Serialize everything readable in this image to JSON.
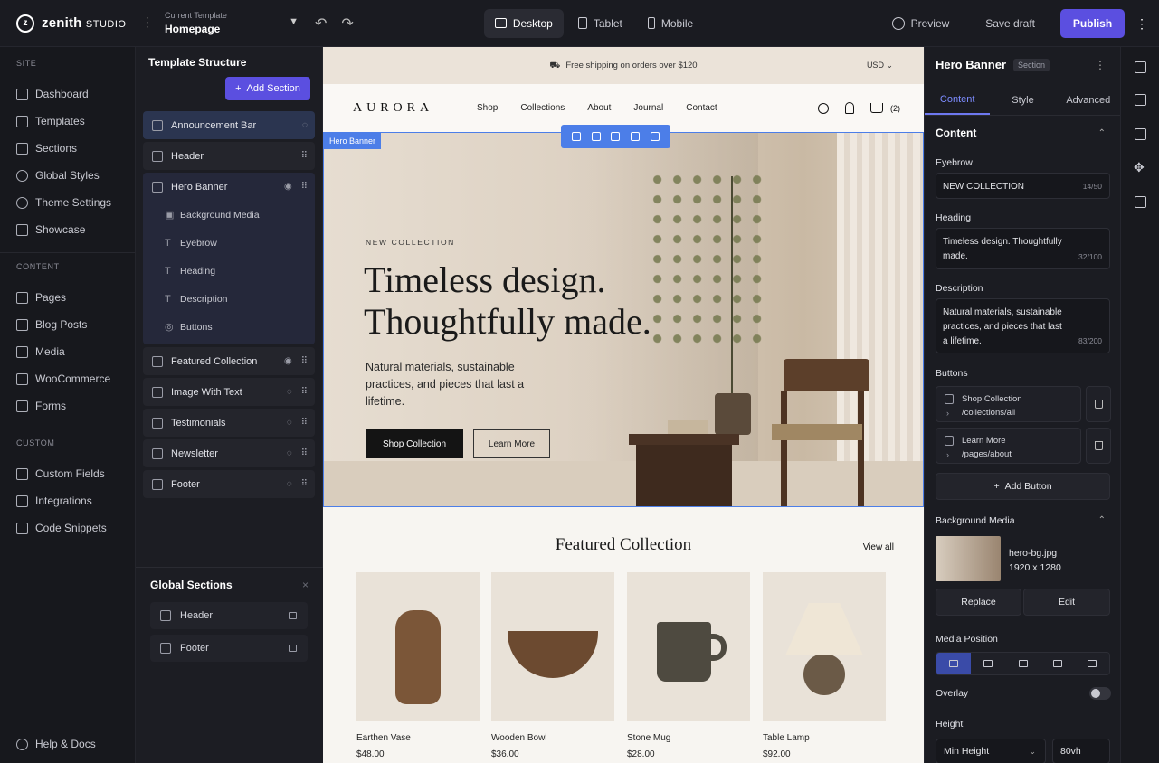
{
  "brand": {
    "name": "zenith",
    "suffix": "STUDIO"
  },
  "template": {
    "label": "Current Template",
    "value": "Homepage"
  },
  "devices": [
    "Desktop",
    "Tablet",
    "Mobile"
  ],
  "topbar": {
    "preview": "Preview",
    "save": "Save draft",
    "publish": "Publish"
  },
  "sidebar": {
    "site_title": "SITE",
    "site": [
      "Dashboard",
      "Templates",
      "Sections",
      "Global Styles",
      "Theme Settings",
      "Showcase"
    ],
    "content_title": "CONTENT",
    "content": [
      "Pages",
      "Blog Posts",
      "Media",
      "WooCommerce",
      "Forms"
    ],
    "custom_title": "CUSTOM",
    "custom": [
      "Custom Fields",
      "Integrations",
      "Code Snippets"
    ],
    "help": "Help & Docs"
  },
  "structure": {
    "title": "Template Structure",
    "add": "Add Section",
    "sections": [
      "Announcement Bar",
      "Header",
      "Hero Banner",
      "Featured Collection",
      "Image With Text",
      "Testimonials",
      "Newsletter",
      "Footer"
    ],
    "hero_children": [
      "Background Media",
      "Eyebrow",
      "Heading",
      "Description",
      "Buttons"
    ],
    "global_title": "Global Sections",
    "global": [
      "Header",
      "Footer"
    ]
  },
  "site": {
    "announcement": "Free shipping on orders over $120",
    "currency": "USD",
    "logo": "AURORA",
    "nav": [
      "Shop",
      "Collections",
      "About",
      "Journal",
      "Contact"
    ],
    "cart_count": "(2)",
    "hero_tag": "Hero Banner",
    "eyebrow": "NEW COLLECTION",
    "heading": "Timeless design.\nThoughtfully made.",
    "description": "Natural materials, sustainable practices, and pieces that last a lifetime.",
    "btn_primary": "Shop Collection",
    "btn_secondary": "Learn More",
    "featured_title": "Featured Collection",
    "view_all": "View all",
    "products": [
      {
        "name": "Earthen Vase",
        "price": "$48.00"
      },
      {
        "name": "Wooden Bowl",
        "price": "$36.00"
      },
      {
        "name": "Stone Mug",
        "price": "$28.00"
      },
      {
        "name": "Table Lamp",
        "price": "$92.00"
      }
    ]
  },
  "props": {
    "title": "Hero Banner",
    "badge": "Section",
    "tabs": [
      "Content",
      "Style",
      "Advanced"
    ],
    "content_title": "Content",
    "eyebrow_label": "Eyebrow",
    "eyebrow_value": "NEW COLLECTION",
    "eyebrow_count": "14/50",
    "heading_label": "Heading",
    "heading_value": "Timeless design. Thoughtfully made.",
    "heading_count": "32/100",
    "description_label": "Description",
    "description_value": "Natural materials, sustainable practices, and pieces that last a lifetime.",
    "description_count": "83/200",
    "buttons_label": "Buttons",
    "buttons": [
      {
        "label": "Shop Collection",
        "url": "/collections/all"
      },
      {
        "label": "Learn More",
        "url": "/pages/about"
      }
    ],
    "add_button": "Add Button",
    "bg_label": "Background Media",
    "bg_file": "hero-bg.jpg",
    "bg_size": "1920 x 1280",
    "replace": "Replace",
    "edit": "Edit",
    "position_label": "Media Position",
    "overlay_label": "Overlay",
    "height_label": "Height",
    "height_mode": "Min Height",
    "height_value": "80vh"
  },
  "colors": {
    "accent": "#5b4fe0",
    "selection": "#4c7ee8"
  }
}
